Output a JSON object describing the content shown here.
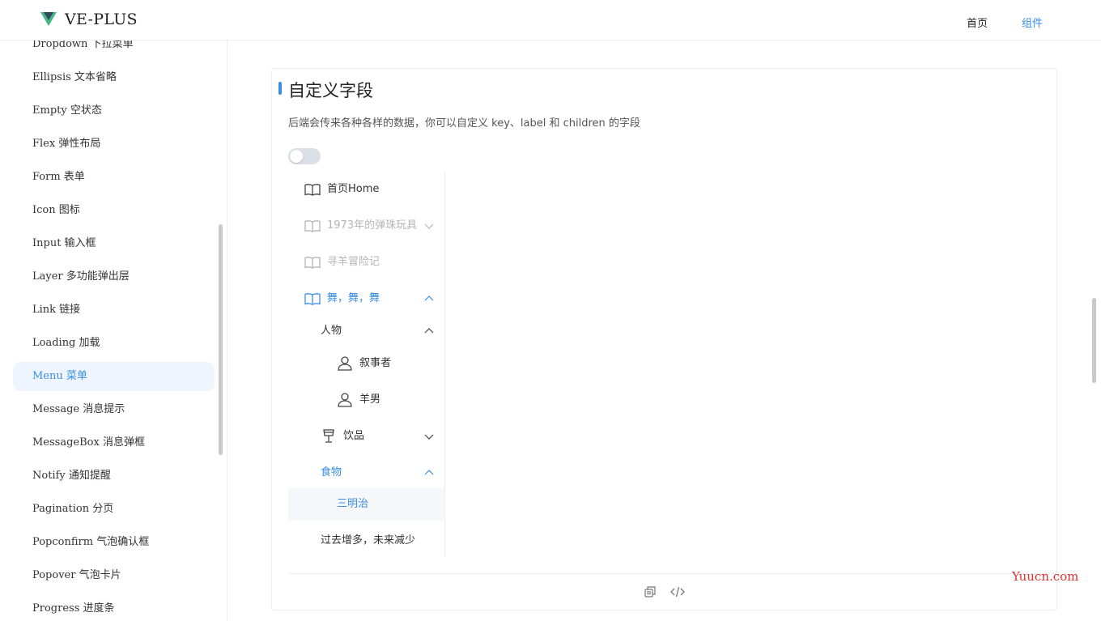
{
  "header": {
    "brand": "VE-PLUS",
    "nav": [
      {
        "label": "首页"
      },
      {
        "label": "组件"
      }
    ]
  },
  "sidebar": {
    "items": [
      {
        "label": "Dropdown 下拉菜单"
      },
      {
        "label": "Ellipsis 文本省略"
      },
      {
        "label": "Empty 空状态"
      },
      {
        "label": "Flex 弹性布局"
      },
      {
        "label": "Form 表单"
      },
      {
        "label": "Icon 图标"
      },
      {
        "label": "Input 输入框"
      },
      {
        "label": "Layer 多功能弹出层"
      },
      {
        "label": "Link 链接"
      },
      {
        "label": "Loading 加载"
      },
      {
        "label": "Menu 菜单"
      },
      {
        "label": "Message 消息提示"
      },
      {
        "label": "MessageBox 消息弹框"
      },
      {
        "label": "Notify 通知提醒"
      },
      {
        "label": "Pagination 分页"
      },
      {
        "label": "Popconfirm 气泡确认框"
      },
      {
        "label": "Popover 气泡卡片"
      },
      {
        "label": "Progress 进度条"
      }
    ],
    "active_index": 10
  },
  "demo": {
    "title": "自定义字段",
    "description": "后端会传来各种各样的数据，你可以自定义 key、label 和 children 的字段",
    "switch_on": false,
    "menu": [
      {
        "label": "首页Home",
        "icon": "book-icon",
        "state": "normal"
      },
      {
        "label": "1973年的弹珠玩具",
        "icon": "book-icon",
        "state": "disabled",
        "arrow": "down"
      },
      {
        "label": "寻羊冒险记",
        "icon": "book-icon",
        "state": "disabled"
      },
      {
        "label": "舞，舞，舞",
        "icon": "book-icon",
        "state": "active-parent",
        "arrow": "up"
      },
      {
        "label": "人物",
        "state": "normal",
        "arrow": "up"
      },
      {
        "label": "叙事者",
        "icon": "user-icon",
        "state": "normal"
      },
      {
        "label": "羊男",
        "icon": "user-icon",
        "state": "normal"
      },
      {
        "label": "饮品",
        "icon": "cup-icon",
        "state": "normal",
        "arrow": "down"
      },
      {
        "label": "食物",
        "state": "active-parent",
        "arrow": "up"
      },
      {
        "label": "三明治",
        "state": "selected"
      },
      {
        "label": "过去增多，未来减少",
        "state": "normal"
      }
    ]
  },
  "watermark": "Yuucn.com",
  "colors": {
    "accent": "#3a8ee6",
    "active_bg": "#eef5fe",
    "selected_bg": "#f5f7fa",
    "disabled": "#b4b4b4",
    "watermark": "#e23030"
  }
}
